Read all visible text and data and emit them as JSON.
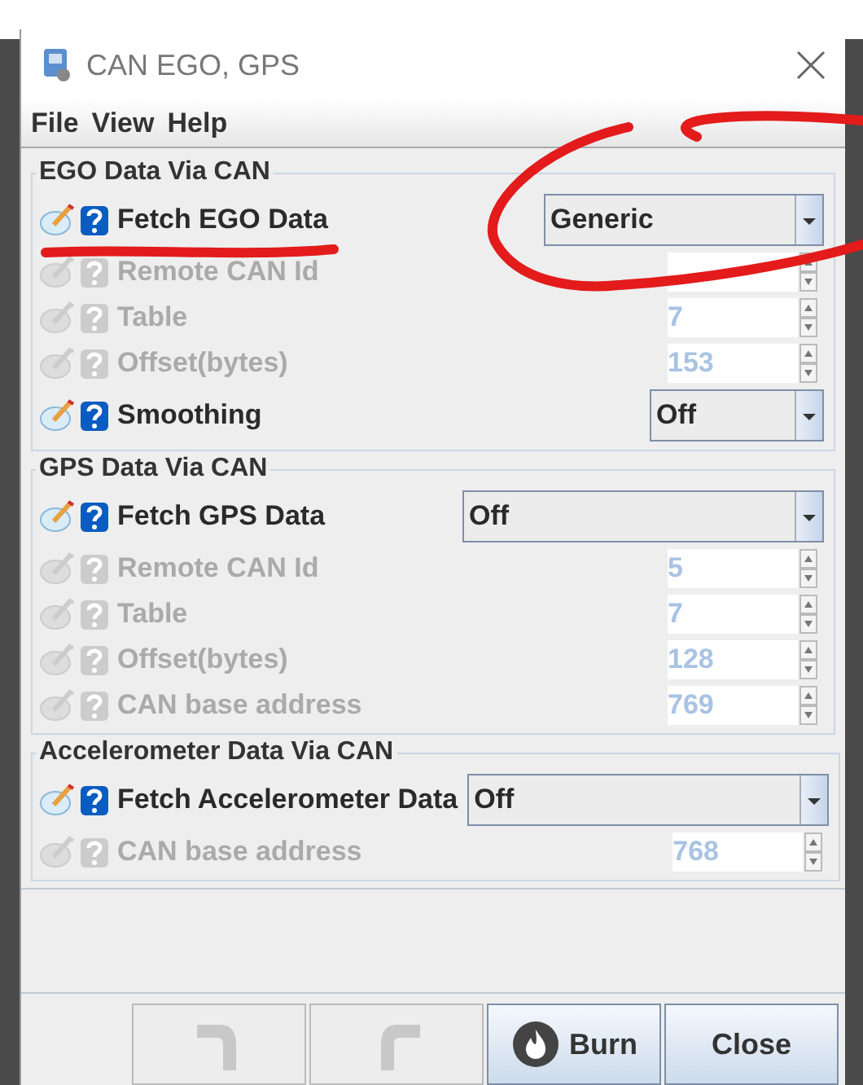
{
  "window": {
    "title": "CAN EGO, GPS"
  },
  "menu": [
    "File",
    "View",
    "Help"
  ],
  "sections": [
    {
      "title": "EGO Data Via CAN",
      "rows": [
        {
          "kind": "combo",
          "label": "Fetch EGO Data",
          "value": "Generic",
          "enabled": true
        },
        {
          "kind": "spinner",
          "label": "Remote CAN Id",
          "enabled": false
        },
        {
          "kind": "spinner",
          "label": "Table",
          "value": "7",
          "enabled": false
        },
        {
          "kind": "spinner",
          "label": "Offset(bytes)",
          "value": "153",
          "enabled": false
        },
        {
          "kind": "combo",
          "label": "Smoothing",
          "value": "Off",
          "enabled": true
        }
      ]
    },
    {
      "title": "GPS Data Via CAN",
      "rows": [
        {
          "kind": "combo",
          "label": "Fetch GPS Data",
          "value": "Off",
          "enabled": true
        },
        {
          "kind": "spinner",
          "label": "Remote CAN Id",
          "value": "5",
          "enabled": false
        },
        {
          "kind": "spinner",
          "label": "Table",
          "value": "7",
          "enabled": false
        },
        {
          "kind": "spinner",
          "label": "Offset(bytes)",
          "value": "128",
          "enabled": false
        },
        {
          "kind": "spinner",
          "label": "CAN base address",
          "value": "769",
          "enabled": false
        }
      ]
    },
    {
      "title": "Accelerometer Data Via CAN",
      "rows": [
        {
          "kind": "combo",
          "label": "Fetch Accelerometer Data",
          "value": "Off",
          "enabled": true
        },
        {
          "kind": "spinner",
          "label": "CAN base address",
          "value": "768",
          "enabled": false
        }
      ]
    }
  ],
  "buttons": [
    {
      "kind": "undo",
      "enabled": false
    },
    {
      "kind": "redo",
      "enabled": false
    },
    {
      "kind": "burn",
      "label": "Burn",
      "enabled": true
    },
    {
      "kind": "close",
      "label": "Close",
      "enabled": true
    }
  ]
}
